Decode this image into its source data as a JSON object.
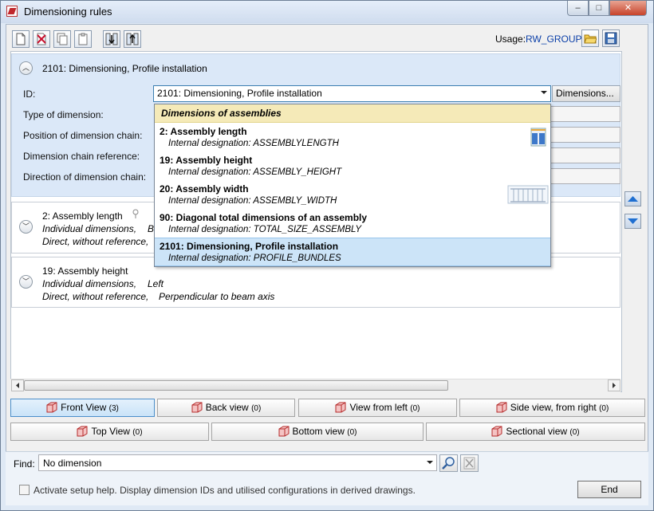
{
  "window": {
    "title": "Dimensioning rules",
    "caption_buttons": {
      "minimize": "–",
      "maximize": "□",
      "close": "✕"
    }
  },
  "toolbar": {
    "icons": [
      "new-icon",
      "delete-icon",
      "copy-icon",
      "paste-icon",
      "move-down-icon",
      "move-up-icon"
    ],
    "usage_label": "Usage:",
    "usage_value": "RW_GROUP",
    "right_icons": [
      "open-folder-icon",
      "save-icon"
    ]
  },
  "rule_panel": {
    "title": "2101: Dimensioning, Profile installation",
    "fields": {
      "id_label": "ID:",
      "id_value": "2101: Dimensioning, Profile installation",
      "dimensions_button": "Dimensions...",
      "type_label": "Type of dimension:",
      "position_label": "Position of dimension chain:",
      "reference_label": "Dimension chain reference:",
      "direction_label": "Direction of dimension chain:"
    }
  },
  "rules": [
    {
      "title": "2: Assembly length",
      "line1_a": "Individual dimensions,",
      "line1_b": "B",
      "line2_a": "Direct, without reference,"
    },
    {
      "title": "19: Assembly height",
      "line1_a": "Individual dimensions,",
      "line1_b": "Left",
      "line2_a": "Direct, without reference,",
      "line2_b": "Perpendicular to beam axis"
    }
  ],
  "dropdown": {
    "header": "Dimensions of assemblies",
    "items": [
      {
        "name": "2: Assembly length",
        "designation": "Internal designation: ASSEMBLYLENGTH"
      },
      {
        "name": "19: Assembly height",
        "designation": "Internal designation: ASSEMBLY_HEIGHT"
      },
      {
        "name": "20: Assembly width",
        "designation": "Internal designation: ASSEMBLY_WIDTH"
      },
      {
        "name": "90: Diagonal total dimensions of an assembly",
        "designation": "Internal designation: TOTAL_SIZE_ASSEMBLY"
      },
      {
        "name": "2101: Dimensioning, Profile installation",
        "designation": "Internal designation: PROFILE_BUNDLES"
      }
    ],
    "selected_index": 4
  },
  "views": {
    "front": {
      "label": "Front View",
      "count": "(3)"
    },
    "back": {
      "label": "Back view",
      "count": "(0)"
    },
    "left": {
      "label": "View from left",
      "count": "(0)"
    },
    "right": {
      "label": "Side view, from right",
      "count": "(0)"
    },
    "top": {
      "label": "Top View",
      "count": "(0)"
    },
    "bottom": {
      "label": "Bottom view",
      "count": "(0)"
    },
    "section": {
      "label": "Sectional view",
      "count": "(0)"
    }
  },
  "find": {
    "label": "Find:",
    "value": "No dimension"
  },
  "setup_help": {
    "label": "Activate setup help. Display dimension IDs and utilised configurations in derived drawings.",
    "checked": false
  },
  "end_button": "End",
  "colors": {
    "selection": "#cce4f8",
    "panel_bg": "#dbe8f8",
    "dropdown_header": "#f5eab8",
    "usage_value": "#0b3fa8"
  }
}
